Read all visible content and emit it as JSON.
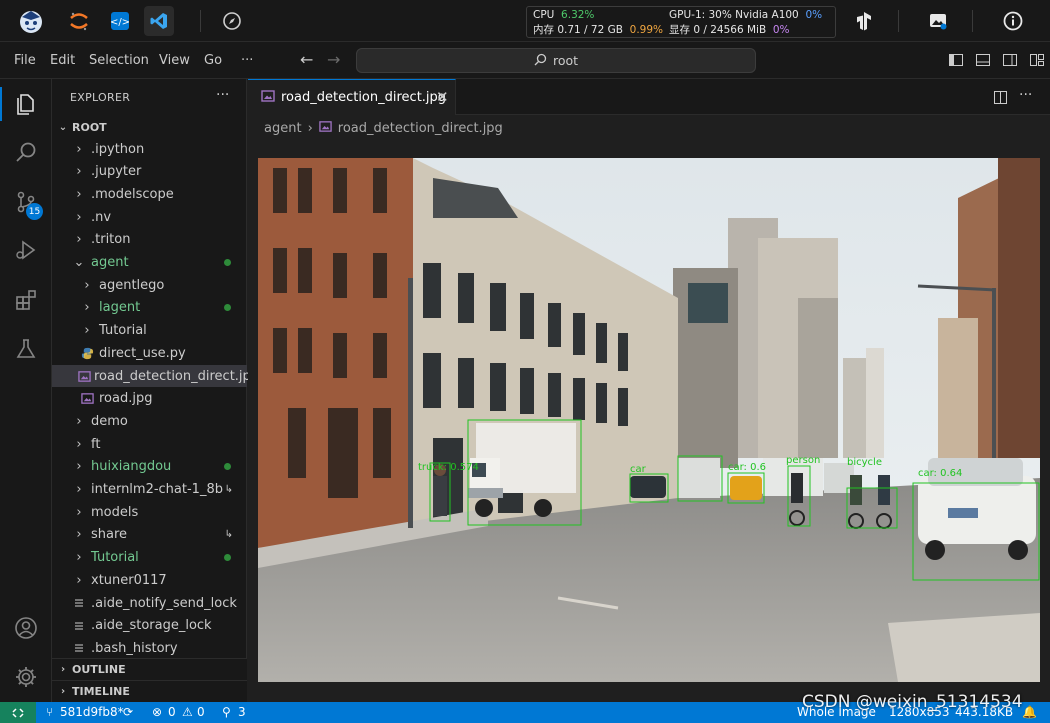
{
  "topbar": {
    "icons": [
      "assistant-avatar-icon",
      "jupyter-icon",
      "vscode-remote-icon",
      "vscode-icon",
      "compass-icon",
      "tensorflow-icon",
      "image-icon",
      "info-icon"
    ],
    "cpu_label": "CPU",
    "cpu_value": "6.32%",
    "mem_label": "内存 0.71 / 72 GB",
    "mem_value": "0.99%",
    "gpu_label": "GPU-1: 30% Nvidia A100",
    "gpu_value": "0%",
    "vram_label": "显存 0 / 24566 MiB",
    "vram_value": "0%"
  },
  "menubar": {
    "items": [
      "File",
      "Edit",
      "Selection",
      "View",
      "Go",
      "···"
    ],
    "search_text": "root"
  },
  "activity_bar": {
    "items": [
      "explorer-icon",
      "search-icon",
      "source-control-icon",
      "run-debug-icon",
      "extensions-icon",
      "testing-icon"
    ],
    "source_control_badge": "15",
    "bottom": [
      "account-icon",
      "settings-gear-icon"
    ]
  },
  "explorer": {
    "title": "EXPLORER",
    "more": "···",
    "root_label": "ROOT",
    "items": [
      {
        "label": ".ipython",
        "kind": "folder",
        "indent": 1,
        "expanded": false,
        "color": "#cccccc"
      },
      {
        "label": ".jupyter",
        "kind": "folder",
        "indent": 1,
        "expanded": false,
        "color": "#cccccc"
      },
      {
        "label": ".modelscope",
        "kind": "folder",
        "indent": 1,
        "expanded": false,
        "color": "#cccccc"
      },
      {
        "label": ".nv",
        "kind": "folder",
        "indent": 1,
        "expanded": false,
        "color": "#cccccc"
      },
      {
        "label": ".triton",
        "kind": "folder",
        "indent": 1,
        "expanded": false,
        "color": "#cccccc"
      },
      {
        "label": "agent",
        "kind": "folder",
        "indent": 1,
        "expanded": true,
        "color": "#73c991",
        "dot": true
      },
      {
        "label": "agentlego",
        "kind": "folder",
        "indent": 2,
        "expanded": false,
        "color": "#cccccc"
      },
      {
        "label": "lagent",
        "kind": "folder",
        "indent": 2,
        "expanded": false,
        "color": "#73c991",
        "dot": true
      },
      {
        "label": "Tutorial",
        "kind": "folder",
        "indent": 2,
        "expanded": false,
        "color": "#cccccc"
      },
      {
        "label": "direct_use.py",
        "kind": "python",
        "indent": 2,
        "color": "#cccccc"
      },
      {
        "label": "road_detection_direct.jpg",
        "kind": "image",
        "indent": 2,
        "color": "#cccccc",
        "selected": true
      },
      {
        "label": "road.jpg",
        "kind": "image",
        "indent": 2,
        "color": "#cccccc"
      },
      {
        "label": "demo",
        "kind": "folder",
        "indent": 1,
        "expanded": false,
        "color": "#cccccc"
      },
      {
        "label": "ft",
        "kind": "folder",
        "indent": 1,
        "expanded": false,
        "color": "#cccccc"
      },
      {
        "label": "huixiangdou",
        "kind": "folder",
        "indent": 1,
        "expanded": false,
        "color": "#73c991",
        "dot": true
      },
      {
        "label": "internlm2-chat-1_8b",
        "kind": "folder",
        "indent": 1,
        "expanded": false,
        "color": "#cccccc",
        "link": true
      },
      {
        "label": "models",
        "kind": "folder",
        "indent": 1,
        "expanded": false,
        "color": "#cccccc"
      },
      {
        "label": "share",
        "kind": "folder",
        "indent": 1,
        "expanded": false,
        "color": "#cccccc",
        "link": true
      },
      {
        "label": "Tutorial",
        "kind": "folder",
        "indent": 1,
        "expanded": false,
        "color": "#73c991",
        "dot": true
      },
      {
        "label": "xtuner0117",
        "kind": "folder",
        "indent": 1,
        "expanded": false,
        "color": "#cccccc"
      },
      {
        "label": ".aide_notify_send_lock",
        "kind": "file",
        "indent": 1,
        "color": "#cccccc"
      },
      {
        "label": ".aide_storage_lock",
        "kind": "file",
        "indent": 1,
        "color": "#cccccc"
      },
      {
        "label": ".bash_history",
        "kind": "file",
        "indent": 1,
        "color": "#cccccc"
      }
    ],
    "outline_label": "OUTLINE",
    "timeline_label": "TIMELINE"
  },
  "editor": {
    "tab_label": "road_detection_direct.jpg",
    "breadcrumb_folder": "agent",
    "breadcrumb_file": "road_detection_direct.jpg",
    "detection_labels": [
      "truck: 0.574",
      "car",
      "car: 0.6",
      "person",
      "bicycle",
      "car: 0.64"
    ]
  },
  "statusbar": {
    "branch": "581d9fb8*",
    "errors": "0",
    "warnings": "0",
    "ports": "3",
    "view_mode": "Whole Image",
    "dimensions": "1280x853",
    "file_size": "443.18KB"
  },
  "watermark": "CSDN @weixin_51314534",
  "colors": {
    "accent": "#0078d4",
    "modified": "#73c991",
    "statusbar": "#0078d4"
  }
}
